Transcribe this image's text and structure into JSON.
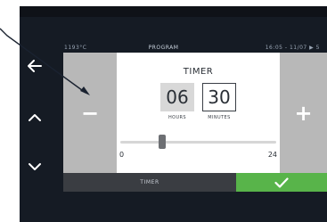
{
  "status_bar": {
    "left_text": "1193°C",
    "center_text": "PROGRAM",
    "right_text": "16:05 - 11/07   ▶ 5"
  },
  "nav": {
    "back_icon": "left-arrow-icon",
    "up_icon": "chevron-up-icon",
    "down_icon": "chevron-down-icon"
  },
  "adjust": {
    "minus_label": "−",
    "plus_label": "+"
  },
  "timer": {
    "title": "TIMER",
    "hours_value": "06",
    "minutes_value": "30",
    "hours_label": "HOURS",
    "minutes_label": "MINUTES"
  },
  "slider": {
    "min_label": "0",
    "max_label": "24",
    "min_value": 0,
    "max_value": 24,
    "value": 6.5
  },
  "bottom_bar": {
    "tab_label": "TIMER",
    "confirm_icon": "checkmark-icon"
  },
  "colors": {
    "frame_bg": "#151b24",
    "side_panel": "#b8b8b8",
    "confirm_green": "#58b44a",
    "callout": "#1a2230"
  }
}
